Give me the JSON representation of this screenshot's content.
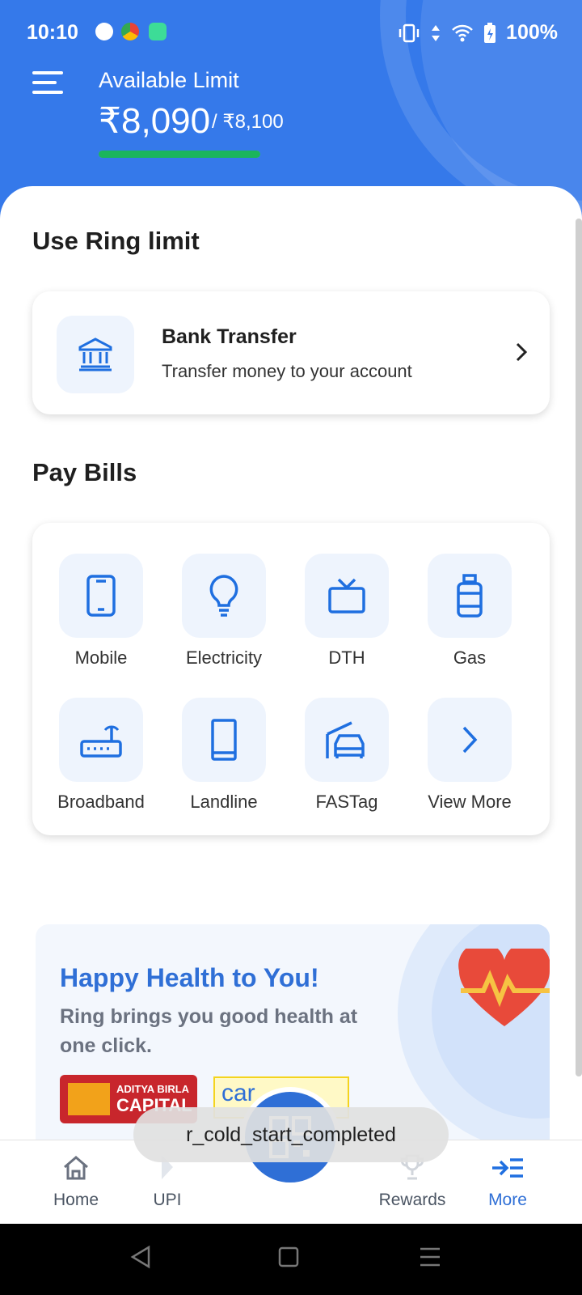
{
  "status_bar": {
    "time": "10:10",
    "battery": "100%",
    "icons": [
      "app-icon-1",
      "chrome-icon",
      "app-icon-3",
      "vibrate-icon",
      "data-arrows-icon",
      "wifi-icon",
      "battery-charging-icon"
    ]
  },
  "header": {
    "available_label": "Available Limit",
    "amount": "₹8,090",
    "total": "/ ₹8,100",
    "limit_used_fraction": 0.9988
  },
  "ring_limit": {
    "title": "Use Ring limit",
    "bank_transfer": {
      "title": "Bank Transfer",
      "subtitle": "Transfer money to your account"
    }
  },
  "pay_bills": {
    "title": "Pay Bills",
    "items": [
      {
        "label": "Mobile",
        "icon": "mobile-icon"
      },
      {
        "label": "Electricity",
        "icon": "bulb-icon"
      },
      {
        "label": "DTH",
        "icon": "tv-icon"
      },
      {
        "label": "Gas",
        "icon": "gas-cylinder-icon"
      },
      {
        "label": "Broadband",
        "icon": "router-icon"
      },
      {
        "label": "Landline",
        "icon": "landline-icon"
      },
      {
        "label": "FASTag",
        "icon": "car-icon"
      },
      {
        "label": "View More",
        "icon": "chevron-right-icon"
      }
    ]
  },
  "banner": {
    "title": "Happy Health to You!",
    "text": "Ring brings you good health at one click.",
    "logo1_line1": "ADITYA BIRLA",
    "logo1_line2": "CAPITAL",
    "logo2": "car"
  },
  "bottom_nav": {
    "items": [
      {
        "label": "Home"
      },
      {
        "label": "UPI"
      },
      {
        "label": "Rewards"
      },
      {
        "label": "More"
      }
    ]
  },
  "toast": "r_cold_start_completed",
  "colors": {
    "primary": "#3579ea",
    "accent_green": "#1bb55c",
    "icon_blue": "#1f6fe0"
  }
}
